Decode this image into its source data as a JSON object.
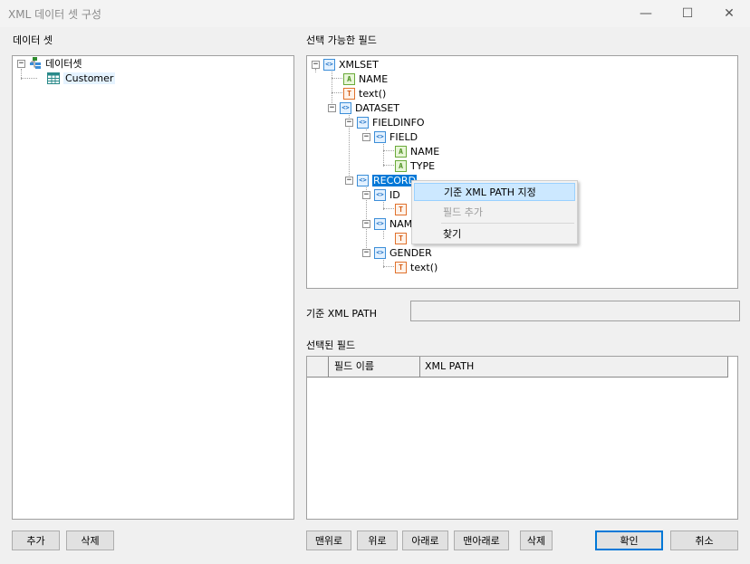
{
  "window": {
    "title": "XML 데이터 셋 구성",
    "minimize": "—",
    "maximize": "☐",
    "close": "✕"
  },
  "left": {
    "header": "데이터 셋",
    "tree": {
      "root": "데이터셋",
      "child": "Customer"
    },
    "add": "추가",
    "delete": "삭제"
  },
  "right": {
    "available_header": "선택 가능한 필드",
    "tree": {
      "xmlset": "XMLSET",
      "name_attr": "NAME",
      "text1": "text()",
      "dataset": "DATASET",
      "fieldinfo": "FIELDINFO",
      "field": "FIELD",
      "field_name": "NAME",
      "field_type": "TYPE",
      "record": "RECORD",
      "id": "ID",
      "name_el": "NAM",
      "gender": "GENDER",
      "text_last": "text()"
    },
    "xmlpath_label": "기준 XML PATH",
    "xmlpath_value": "",
    "selected_header": "선택된 필드",
    "columns": {
      "field_name": "필드 이름",
      "xml_path": "XML PATH"
    },
    "buttons": {
      "top": "맨위로",
      "up": "위로",
      "down": "아래로",
      "bottom": "맨아래로",
      "delete": "삭제"
    }
  },
  "context_menu": {
    "set_path": "기준 XML PATH 지정",
    "add_field": "필드 추가",
    "find": "찾기"
  },
  "dialog": {
    "ok": "확인",
    "cancel": "취소"
  },
  "icons": {
    "tag": "<>",
    "attr": "A",
    "text": "T",
    "expanded": "−"
  }
}
